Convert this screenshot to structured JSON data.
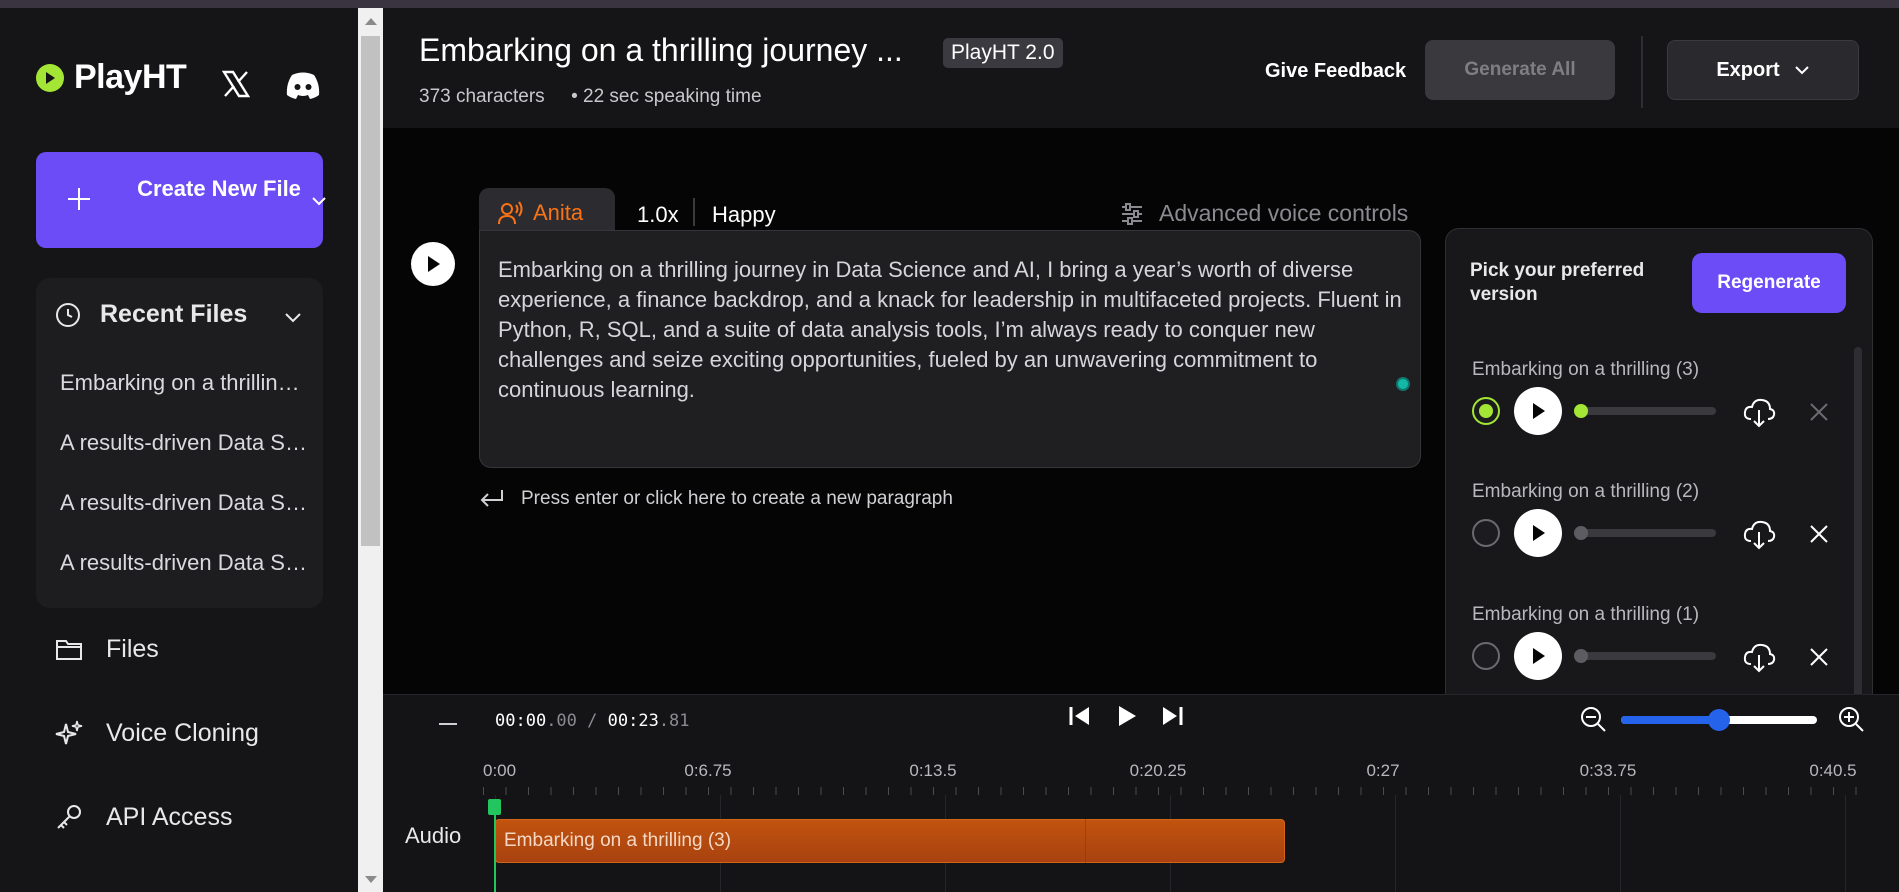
{
  "sidebar": {
    "brand": "PlayHT",
    "create_label": "Create New File",
    "recent_title": "Recent Files",
    "recent_files": [
      "Embarking on a thrilling journey in Data Science and AI",
      "A results-driven Data Scientist",
      "A results-driven Data Scientist",
      "A results-driven Data Scientist"
    ],
    "nav": [
      {
        "label": "Files",
        "icon": "folder-icon"
      },
      {
        "label": "Voice Cloning",
        "icon": "sparkle-icon"
      },
      {
        "label": "API Access",
        "icon": "key-icon"
      }
    ]
  },
  "header": {
    "title": "Embarking on a thrilling journey ...",
    "model": "PlayHT 2.0",
    "characters": "373 characters",
    "speaking_time": "• 22 sec speaking time",
    "feedback": "Give Feedback",
    "generate_all": "Generate All",
    "export": "Export"
  },
  "paragraph": {
    "voice": "Anita",
    "speed": "1.0x",
    "emotion": "Happy",
    "advanced": "Advanced voice controls",
    "text": "Embarking on a thrilling journey in Data Science and AI, I bring a year’s worth of diverse experience, a finance backdrop, and a knack for leadership in multifaceted projects. Fluent in Python, R, SQL, and a suite of data analysis tools, I’m always ready to conquer new challenges and seize exciting opportunities, fueled by an unwavering commitment to continuous learning.",
    "new_paragraph_hint": "Press enter or click here to create a new paragraph"
  },
  "versions": {
    "pick_label": "Pick your preferred version",
    "regenerate": "Regenerate",
    "items": [
      {
        "name": "Embarking on a thrilling (3)",
        "selected": true
      },
      {
        "name": "Embarking on a thrilling (2)",
        "selected": false
      },
      {
        "name": "Embarking on a thrilling (1)",
        "selected": false
      }
    ]
  },
  "timeline": {
    "current_main": "00:00",
    "current_frac": ".00",
    "separator": " / ",
    "total_main": "00:23",
    "total_frac": ".81",
    "zoom_level": 0.5,
    "ticks": [
      "0:00",
      "0:6.75",
      "0:13.5",
      "0:20.25",
      "0:27",
      "0:33.75",
      "0:40.5"
    ],
    "track_label": "Audio",
    "clip_label": "Embarking on a thrilling (3)"
  },
  "colors": {
    "accent": "#6b4cf6",
    "brand_green": "#a3e635",
    "voice_orange": "#f97316",
    "clip": "#b4490f",
    "playhead": "#22c55e"
  }
}
